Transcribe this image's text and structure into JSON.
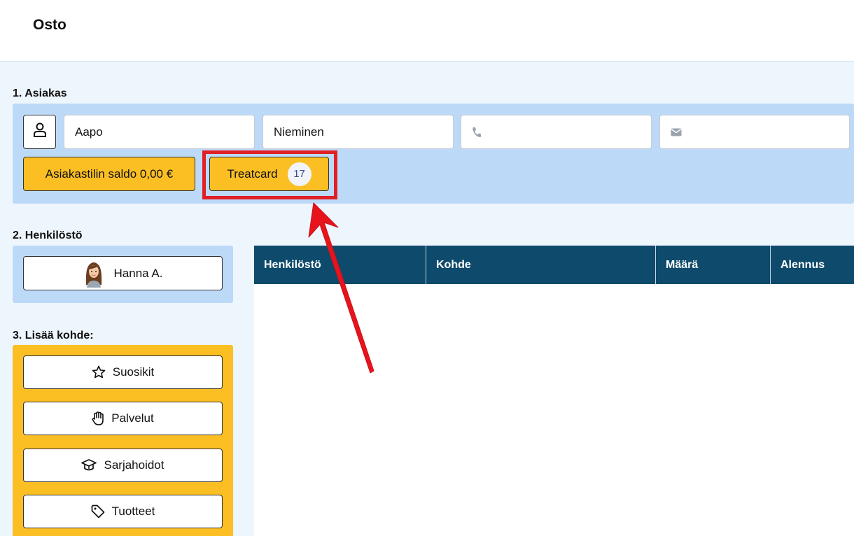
{
  "page": {
    "title": "Osto"
  },
  "customer": {
    "section_label": "1. Asiakas",
    "first_name": "Aapo",
    "last_name": "Nieminen",
    "phone": "",
    "email": "",
    "balance_label": "Asiakastilin saldo 0,00 €",
    "treatcard_label": "Treatcard",
    "treatcard_count": "17"
  },
  "staff": {
    "section_label": "2. Henkilöstö",
    "selected": "Hanna A."
  },
  "add_item": {
    "section_label": "3. Lisää kohde:",
    "buttons": [
      {
        "label": "Suosikit",
        "icon": "star-icon"
      },
      {
        "label": "Palvelut",
        "icon": "hand-icon"
      },
      {
        "label": "Sarjahoidot",
        "icon": "box-icon"
      },
      {
        "label": "Tuotteet",
        "icon": "tag-icon"
      }
    ]
  },
  "table": {
    "headers": [
      "Henkilöstö",
      "Kohde",
      "Määrä",
      "Alennus"
    ]
  },
  "colors": {
    "accent_yellow": "#fbbf24",
    "panel_blue": "#bcd9f8",
    "table_header": "#0e4a6b",
    "highlight_red": "#e01f26"
  }
}
